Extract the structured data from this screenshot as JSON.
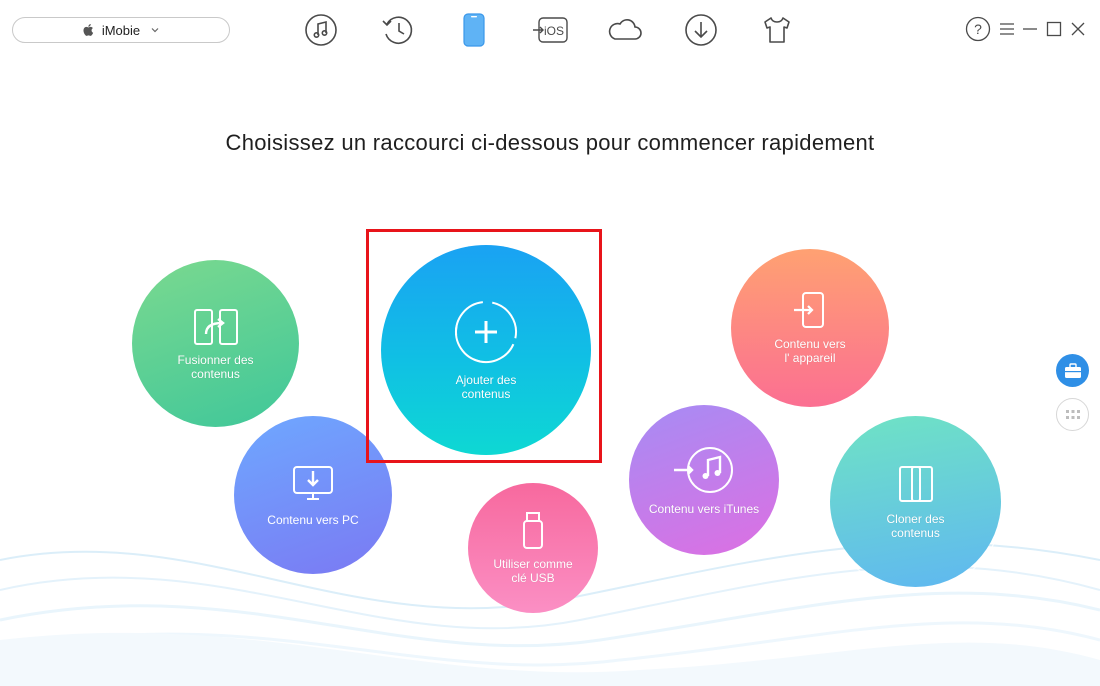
{
  "device": {
    "name": "iMobie",
    "icon": "apple-icon"
  },
  "nav": {
    "items": [
      {
        "name": "music-icon"
      },
      {
        "name": "history-icon"
      },
      {
        "name": "phone-icon",
        "active": true
      },
      {
        "name": "to-ios-icon",
        "label": "iOS"
      },
      {
        "name": "cloud-icon"
      },
      {
        "name": "download-icon"
      },
      {
        "name": "tshirt-icon"
      }
    ]
  },
  "window": {
    "help": "?",
    "controls": [
      "menu-icon",
      "minimize-icon",
      "maximize-icon",
      "close-icon"
    ]
  },
  "headline": "Choisissez un raccourci ci-dessous pour commencer rapidement",
  "shortcuts": {
    "merge": {
      "label_line1": "Fusionner des",
      "label_line2": "contenus"
    },
    "pc": {
      "label": "Contenu vers PC"
    },
    "add": {
      "label_line1": "Ajouter des",
      "label_line2": "contenus"
    },
    "usb": {
      "label_line1": "Utiliser comme",
      "label_line2": "clé USB"
    },
    "itunes": {
      "label": "Contenu vers iTunes"
    },
    "device": {
      "label_line1": "Contenu vers",
      "label_line2": "l' appareil"
    },
    "clone": {
      "label_line1": "Cloner des",
      "label_line2": "contenus"
    }
  },
  "colors": {
    "accent": "#2f8fe6",
    "highlight": "#e8141a",
    "merge": "#3fc79a",
    "pc": "#7b79f3",
    "add": "#10c0e4",
    "usb": "#f7699e",
    "itunes": "#c27ce9",
    "device": "#fb6f92",
    "clone": "#5fb7f1"
  }
}
